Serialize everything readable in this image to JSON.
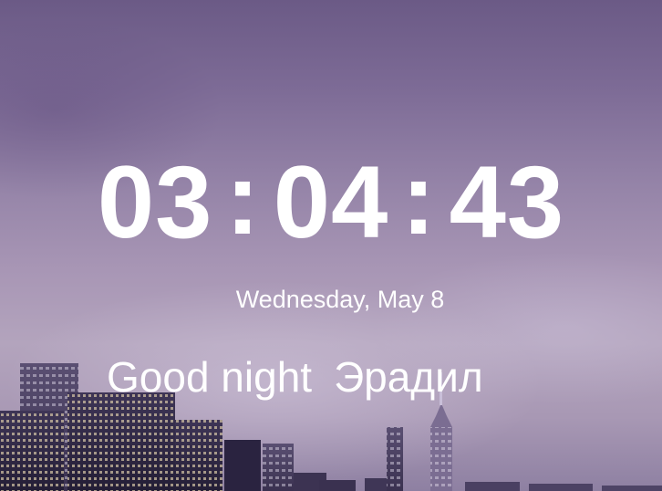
{
  "clock": {
    "hours": "03",
    "minutes": "04",
    "seconds": "43",
    "separator": ":"
  },
  "date": "Wednesday, May 8",
  "greeting": {
    "text": "Good night",
    "name": "Эрадил"
  },
  "colors": {
    "text": "#ffffff",
    "sky_top": "#6b5a86",
    "sky_mid": "#a896b5"
  },
  "background": {
    "subject": "city-skyline-at-night"
  }
}
